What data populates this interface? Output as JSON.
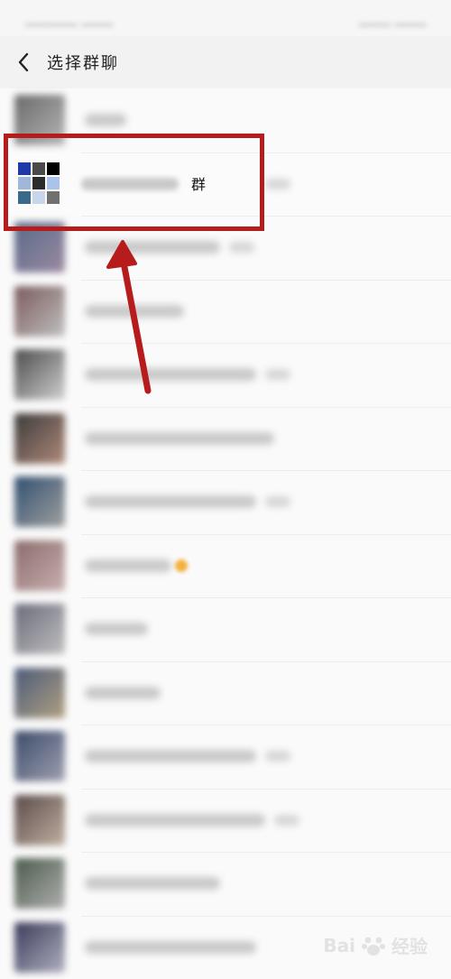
{
  "status_bar": {},
  "nav": {
    "title": "选择群聊",
    "back_icon": "chevron-left-icon"
  },
  "list": {
    "highlighted_group_label": "群",
    "rows": [
      {
        "avatar_colors": [
          "#6a6a6a",
          "#b5b5b5"
        ]
      },
      {
        "avatar_colors": [
          "#1f3aa6",
          "#4a4a4a",
          "#000000",
          "#9fb8d9",
          "#2c2c2c",
          "#a9c4e8",
          "#3a6a8a",
          "#c7d6ea",
          "#707070"
        ],
        "highlight": true
      },
      {
        "avatar_colors": [
          "#5a6a8a",
          "#9a8aa0"
        ]
      },
      {
        "avatar_colors": [
          "#7a5a5a",
          "#c0c0c0"
        ]
      },
      {
        "avatar_colors": [
          "#4a4a4a",
          "#d0d0d0"
        ]
      },
      {
        "avatar_colors": [
          "#3a3a3a",
          "#b08a7a"
        ]
      },
      {
        "avatar_colors": [
          "#2f4f6f",
          "#a0a0a0"
        ]
      },
      {
        "avatar_colors": [
          "#8a6a6a",
          "#c9b0b0"
        ]
      },
      {
        "avatar_colors": [
          "#6a6a7a",
          "#c0c0c0"
        ]
      },
      {
        "avatar_colors": [
          "#4a5a7a",
          "#b0a080"
        ]
      },
      {
        "avatar_colors": [
          "#3a4a6a",
          "#a0a0b0"
        ]
      },
      {
        "avatar_colors": [
          "#5a4a4a",
          "#c0b0a0"
        ]
      },
      {
        "avatar_colors": [
          "#4a5a4a",
          "#b0b0b0"
        ]
      },
      {
        "avatar_colors": [
          "#3a3a5a",
          "#b0b0c0"
        ]
      }
    ]
  },
  "annotation": {
    "box_color": "#b71c1c",
    "arrow_color": "#b71c1c"
  },
  "watermark": {
    "text_left": "Bai",
    "text_right": "经验",
    "paw_icon": "baidu-paw-icon"
  }
}
